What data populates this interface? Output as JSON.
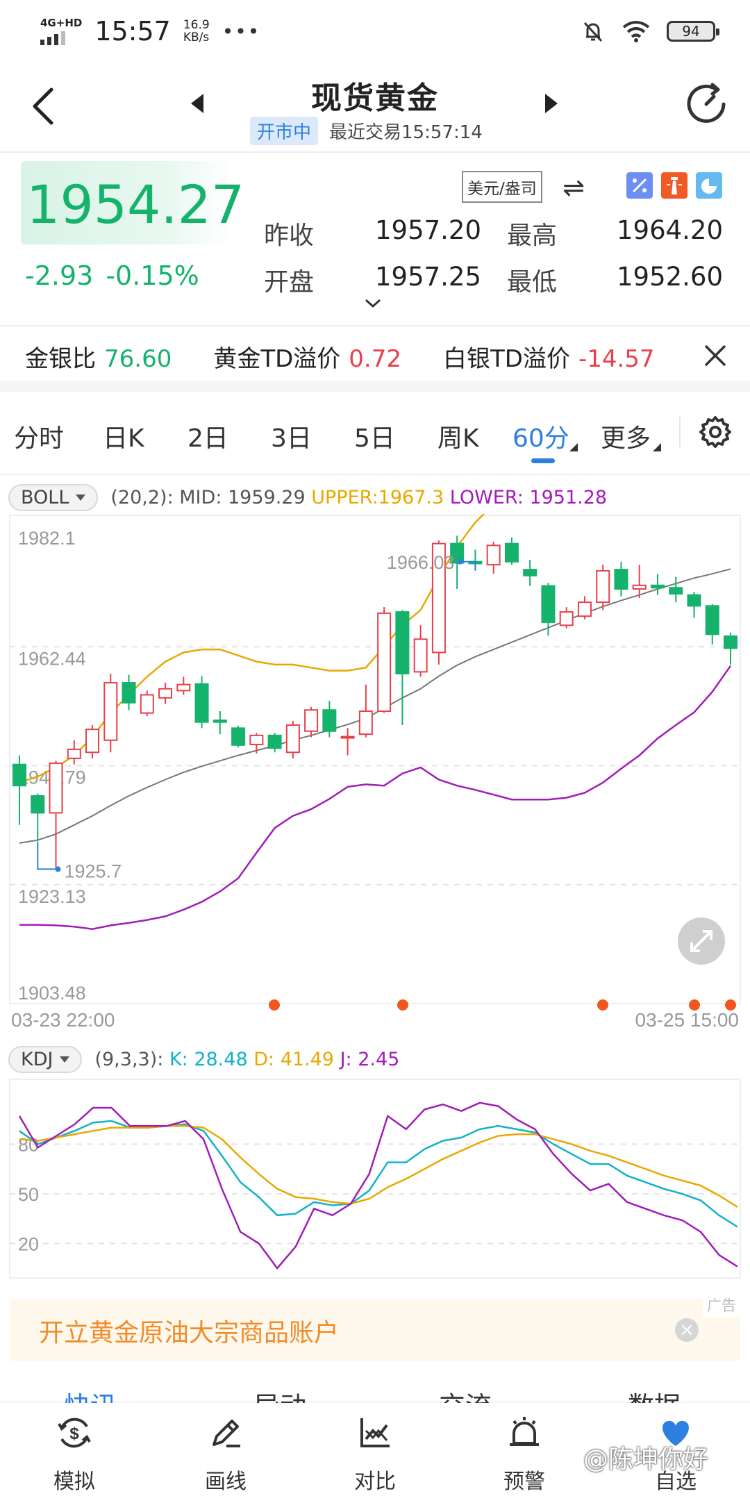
{
  "status": {
    "network": "4G+HD",
    "time": "15:57",
    "speed_value": "16.9",
    "speed_unit": "KB/s",
    "more": "•••",
    "battery": "94"
  },
  "header": {
    "title": "现货黄金",
    "market_status": "开市中",
    "last_trade": "最近交易15:57:14"
  },
  "quote": {
    "price": "1954.27",
    "change": "-2.93",
    "change_pct": "-0.15%",
    "prev_close_label": "昨收",
    "prev_close": "1957.20",
    "open_label": "开盘",
    "open": "1957.25",
    "high_label": "最高",
    "high": "1964.20",
    "low_label": "最低",
    "low": "1952.60",
    "unit": "美元/盎司",
    "swap_icon": "⇌",
    "up_color": "#e8404a",
    "down_color": "#14b26a"
  },
  "ratios": [
    {
      "label": "金银比",
      "value": "76.60",
      "tone": "green"
    },
    {
      "label": "黄金TD溢价",
      "value": "0.72",
      "tone": "red"
    },
    {
      "label": "白银TD溢价",
      "value": "-14.57",
      "tone": "red"
    }
  ],
  "tabs": [
    "分时",
    "日K",
    "2日",
    "3日",
    "5日",
    "周K",
    "60分",
    "更多"
  ],
  "active_tab": "60分",
  "boll": {
    "button": "BOLL",
    "params": "(20,2):",
    "mid": "MID: 1959.29",
    "upper": "UPPER:1967.3",
    "lower": "LOWER: 1951.28"
  },
  "kdj": {
    "button": "KDJ",
    "params": "(9,3,3):",
    "k": "K: 28.48",
    "d": "D: 41.49",
    "j": "J: 2.45"
  },
  "chart_data": [
    {
      "type": "candlestick",
      "indicator": "BOLL(20,2)",
      "y_ticks": [
        "1982.1",
        "1962.44",
        "1942.79",
        "1923.13",
        "1903.48"
      ],
      "ylim": [
        1903.48,
        1982.1
      ],
      "x_start": "03-23 22:00",
      "x_end": "03-25 15:00",
      "max_label": "1966.03",
      "min_label": "1925.7",
      "candles": [
        {
          "o": 1943.0,
          "c": 1939.5,
          "h": 1944.5,
          "l": 1933.0
        },
        {
          "o": 1937.8,
          "c": 1935.0,
          "h": 1938.2,
          "l": 1930.5
        },
        {
          "o": 1935.0,
          "c": 1943.2,
          "h": 1943.6,
          "l": 1925.7
        },
        {
          "o": 1944.0,
          "c": 1945.5,
          "h": 1947.0,
          "l": 1943.0
        },
        {
          "o": 1945.0,
          "c": 1948.8,
          "h": 1949.5,
          "l": 1944.0
        },
        {
          "o": 1947.0,
          "c": 1956.5,
          "h": 1958.0,
          "l": 1945.0
        },
        {
          "o": 1956.5,
          "c": 1953.2,
          "h": 1957.8,
          "l": 1952.0
        },
        {
          "o": 1951.5,
          "c": 1954.5,
          "h": 1955.2,
          "l": 1951.0
        },
        {
          "o": 1954.0,
          "c": 1955.5,
          "h": 1956.5,
          "l": 1953.0
        },
        {
          "o": 1955.2,
          "c": 1956.2,
          "h": 1957.5,
          "l": 1954.5
        },
        {
          "o": 1956.3,
          "c": 1950.0,
          "h": 1957.6,
          "l": 1949.0
        },
        {
          "o": 1950.3,
          "c": 1950.0,
          "h": 1951.8,
          "l": 1948.0
        },
        {
          "o": 1949.0,
          "c": 1946.2,
          "h": 1949.4,
          "l": 1945.8
        },
        {
          "o": 1946.3,
          "c": 1947.8,
          "h": 1948.2,
          "l": 1944.8
        },
        {
          "o": 1947.8,
          "c": 1945.7,
          "h": 1948.2,
          "l": 1945.0
        },
        {
          "o": 1945.0,
          "c": 1949.5,
          "h": 1950.2,
          "l": 1944.0
        },
        {
          "o": 1948.5,
          "c": 1952.0,
          "h": 1952.5,
          "l": 1947.5
        },
        {
          "o": 1952.0,
          "c": 1948.5,
          "h": 1953.5,
          "l": 1947.5
        },
        {
          "o": 1947.5,
          "c": 1947.6,
          "h": 1949.0,
          "l": 1944.5
        },
        {
          "o": 1948.0,
          "c": 1951.8,
          "h": 1956.2,
          "l": 1947.5
        },
        {
          "o": 1951.8,
          "c": 1968.0,
          "h": 1969.0,
          "l": 1951.5
        },
        {
          "o": 1968.2,
          "c": 1958.0,
          "h": 1968.5,
          "l": 1949.5
        },
        {
          "o": 1958.3,
          "c": 1963.7,
          "h": 1966.0,
          "l": 1957.5
        },
        {
          "o": 1961.5,
          "c": 1979.5,
          "h": 1980.0,
          "l": 1959.5
        },
        {
          "o": 1979.5,
          "c": 1976.3,
          "h": 1980.8,
          "l": 1972.0
        },
        {
          "o": 1976.5,
          "c": 1976.2,
          "h": 1978.5,
          "l": 1975.0
        },
        {
          "o": 1976.0,
          "c": 1979.2,
          "h": 1979.8,
          "l": 1974.5
        },
        {
          "o": 1979.5,
          "c": 1976.5,
          "h": 1980.5,
          "l": 1976.0
        },
        {
          "o": 1975.2,
          "c": 1974.2,
          "h": 1976.8,
          "l": 1972.5
        },
        {
          "o": 1972.5,
          "c": 1966.5,
          "h": 1973.0,
          "l": 1964.3
        },
        {
          "o": 1966.0,
          "c": 1968.2,
          "h": 1969.0,
          "l": 1965.5
        },
        {
          "o": 1967.5,
          "c": 1969.8,
          "h": 1970.8,
          "l": 1967.0
        },
        {
          "o": 1969.8,
          "c": 1975.0,
          "h": 1976.0,
          "l": 1968.5
        },
        {
          "o": 1975.2,
          "c": 1972.0,
          "h": 1976.5,
          "l": 1970.8
        },
        {
          "o": 1972.0,
          "c": 1972.6,
          "h": 1976.0,
          "l": 1970.5
        },
        {
          "o": 1972.6,
          "c": 1972.2,
          "h": 1974.5,
          "l": 1971.0
        },
        {
          "o": 1972.2,
          "c": 1971.2,
          "h": 1974.0,
          "l": 1969.8
        },
        {
          "o": 1971.0,
          "c": 1969.2,
          "h": 1971.5,
          "l": 1967.2
        },
        {
          "o": 1969.2,
          "c": 1964.5,
          "h": 1969.5,
          "l": 1962.8
        },
        {
          "o": 1964.2,
          "c": 1962.2,
          "h": 1964.8,
          "l": 1959.5
        }
      ],
      "boll_upper": [
        1940.0,
        1941.0,
        1942.5,
        1944.5,
        1947.5,
        1951.5,
        1954.5,
        1957.5,
        1960.0,
        1961.5,
        1962.0,
        1962.0,
        1961.0,
        1960.0,
        1959.5,
        1959.5,
        1959.0,
        1958.5,
        1958.5,
        1959.0,
        1962.5,
        1966.0,
        1968.5,
        1974.0,
        1979.0,
        1983.0,
        1986.0,
        1988.0,
        1989.5,
        1990.5,
        1991.5,
        1992.5,
        1993.5,
        1993.8,
        1993.8,
        1993.5,
        1993.3,
        1992.5,
        1990.5,
        1986.5
      ],
      "boll_mid": [
        1930.0,
        1930.5,
        1931.5,
        1933.0,
        1934.5,
        1936.2,
        1937.8,
        1939.2,
        1940.5,
        1941.7,
        1942.7,
        1943.6,
        1944.5,
        1945.3,
        1946.1,
        1947.0,
        1947.8,
        1948.7,
        1949.6,
        1950.6,
        1952.3,
        1954.0,
        1955.5,
        1957.6,
        1959.4,
        1960.8,
        1962.0,
        1963.2,
        1964.4,
        1965.6,
        1966.8,
        1968.0,
        1969.1,
        1970.1,
        1971.0,
        1972.0,
        1972.9,
        1973.8,
        1974.5,
        1975.3
      ],
      "boll_lower": [
        1916.5,
        1916.5,
        1916.4,
        1916.2,
        1915.8,
        1916.4,
        1916.8,
        1917.3,
        1917.9,
        1919.0,
        1920.3,
        1922.0,
        1924.2,
        1928.4,
        1932.5,
        1934.5,
        1935.6,
        1937.3,
        1939.3,
        1939.7,
        1939.5,
        1941.5,
        1942.5,
        1940.5,
        1939.5,
        1938.8,
        1938.0,
        1937.2,
        1937.2,
        1937.2,
        1937.5,
        1938.3,
        1940.0,
        1942.3,
        1944.5,
        1947.3,
        1949.5,
        1951.6,
        1955.0,
        1959.3
      ]
    },
    {
      "type": "line",
      "indicator": "KDJ(9,3,3)",
      "y_ticks": [
        "80",
        "50",
        "20"
      ],
      "ylim": [
        0,
        115
      ],
      "series": [
        {
          "name": "K",
          "color": "#10b3c6",
          "values": [
            88,
            80,
            84,
            88,
            93,
            94,
            90,
            90,
            91,
            92,
            88,
            73,
            57,
            48,
            37,
            38,
            45,
            43,
            44,
            52,
            69,
            69,
            77,
            82,
            84,
            89,
            91,
            89,
            87,
            80,
            74,
            68,
            68,
            61,
            57,
            53,
            50,
            46,
            37,
            30
          ]
        },
        {
          "name": "D",
          "color": "#e9a800",
          "values": [
            83,
            82,
            84,
            86,
            88,
            90,
            90,
            90,
            91,
            91,
            90,
            83,
            72,
            62,
            53,
            48,
            47,
            45,
            44,
            47,
            54,
            59,
            65,
            71,
            76,
            81,
            85,
            86,
            86,
            83,
            80,
            76,
            73,
            69,
            65,
            61,
            58,
            55,
            49,
            42
          ]
        },
        {
          "name": "J",
          "color": "#a11cb8",
          "values": [
            97,
            78,
            85,
            92,
            102,
            102,
            91,
            91,
            91,
            94,
            83,
            53,
            27,
            20,
            5,
            18,
            41,
            37,
            44,
            62,
            97,
            89,
            101,
            104,
            100,
            105,
            103,
            95,
            89,
            74,
            62,
            52,
            56,
            45,
            41,
            37,
            34,
            27,
            13,
            6
          ]
        }
      ]
    }
  ],
  "ad": {
    "text": "开立黄金原油大宗商品账户",
    "tag": "广告",
    "close": "×"
  },
  "section_tabs": [
    "快讯",
    "异动",
    "交流",
    "数据"
  ],
  "bottom_nav": [
    {
      "label": "模拟",
      "icon": "dollar-exchange-icon"
    },
    {
      "label": "画线",
      "icon": "pen-icon"
    },
    {
      "label": "对比",
      "icon": "compare-chart-icon"
    },
    {
      "label": "预警",
      "icon": "alarm-bell-icon"
    },
    {
      "label": "自选",
      "icon": "heart-icon"
    }
  ],
  "watermark": "@陈坤你好"
}
